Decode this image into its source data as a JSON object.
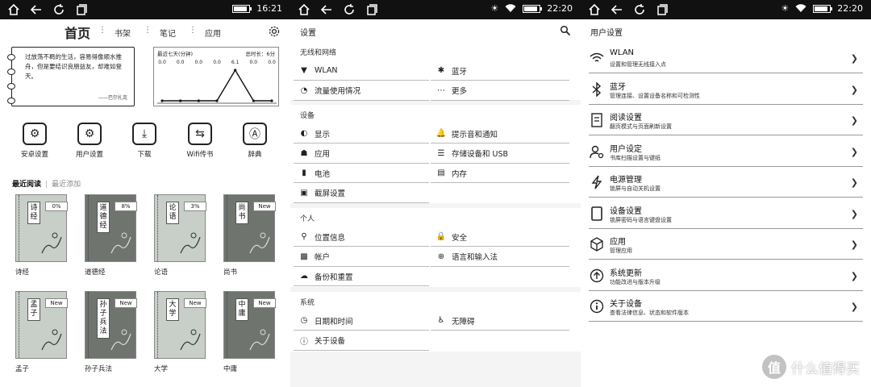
{
  "statusbars": [
    {
      "time": "16:21",
      "show_wifi": false
    },
    {
      "time": "22:20",
      "show_wifi": true
    },
    {
      "time": "22:20",
      "show_wifi": true
    }
  ],
  "home": {
    "title": "首页",
    "tabs": [
      "书架",
      "笔记",
      "应用"
    ],
    "quote": {
      "text": "过放荡不羁的生活，容易得像顺水推舟，但是要结识良朋益友，却难如登天。",
      "author": "——巴尔扎克"
    },
    "stats": {
      "label": "最近七天(分钟)",
      "total": "总时长：6分",
      "chart_data": {
        "type": "line",
        "values": [
          0.0,
          0.0,
          0.0,
          0.0,
          6.1,
          0.0,
          0.0
        ],
        "value_labels": [
          "0.0",
          "0.0",
          "0.0",
          "0.0",
          "6.1",
          "0.0",
          "0.0"
        ],
        "ylim": [
          0,
          6.1
        ]
      }
    },
    "apps": [
      {
        "label": "安卓设置",
        "icon": "gear-icon"
      },
      {
        "label": "用户设置",
        "icon": "gear-icon"
      },
      {
        "label": "下载",
        "icon": "download-icon"
      },
      {
        "label": "Wifi传书",
        "icon": "transfer-icon"
      },
      {
        "label": "辞典",
        "icon": "dictionary-icon"
      }
    ],
    "recent_tab_active": "最近阅读",
    "recent_tab_inactive": "最近添加",
    "books": [
      {
        "title": "诗经",
        "cover_chars": "诗经",
        "badge": "0%",
        "dark": false
      },
      {
        "title": "道德经",
        "cover_chars": "道德经",
        "badge": "8%",
        "dark": true
      },
      {
        "title": "论语",
        "cover_chars": "论语",
        "badge": "3%",
        "dark": false
      },
      {
        "title": "尚书",
        "cover_chars": "尚书",
        "badge": "New",
        "dark": true
      },
      {
        "title": "孟子",
        "cover_chars": "孟子",
        "badge": "New",
        "dark": false
      },
      {
        "title": "孙子兵法",
        "cover_chars": "孙子兵法",
        "badge": "New",
        "dark": true
      },
      {
        "title": "大学",
        "cover_chars": "大学",
        "badge": "New",
        "dark": false
      },
      {
        "title": "中庸",
        "cover_chars": "中庸",
        "badge": "New",
        "dark": true
      }
    ]
  },
  "settings": {
    "title": "设置",
    "sections": [
      {
        "header": "无线和网络",
        "items": [
          {
            "label": "WLAN",
            "icon": "wifi-icon"
          },
          {
            "label": "蓝牙",
            "icon": "bluetooth-icon"
          },
          {
            "label": "流量使用情况",
            "icon": "data-usage-icon"
          },
          {
            "label": "更多",
            "icon": "more-icon"
          }
        ]
      },
      {
        "header": "设备",
        "items": [
          {
            "label": "显示",
            "icon": "brightness-icon"
          },
          {
            "label": "提示音和通知",
            "icon": "bell-icon"
          },
          {
            "label": "应用",
            "icon": "android-icon"
          },
          {
            "label": "存储设备和 USB",
            "icon": "storage-icon"
          },
          {
            "label": "电池",
            "icon": "battery-icon"
          },
          {
            "label": "内存",
            "icon": "memory-icon"
          },
          {
            "label": "截屏设置",
            "icon": "screenshot-icon"
          }
        ]
      },
      {
        "header": "个人",
        "items": [
          {
            "label": "位置信息",
            "icon": "location-icon"
          },
          {
            "label": "安全",
            "icon": "lock-icon"
          },
          {
            "label": "帐户",
            "icon": "account-icon"
          },
          {
            "label": "语言和输入法",
            "icon": "globe-icon"
          },
          {
            "label": "备份和重置",
            "icon": "cloud-icon"
          }
        ]
      },
      {
        "header": "系统",
        "items": [
          {
            "label": "日期和时间",
            "icon": "clock-icon"
          },
          {
            "label": "无障碍",
            "icon": "accessibility-icon"
          },
          {
            "label": "关于设备",
            "icon": "info-icon"
          }
        ]
      }
    ]
  },
  "user_settings": {
    "title": "用户设置",
    "items": [
      {
        "title": "WLAN",
        "subtitle": "设置和管理无线接入点",
        "icon": "wifi-icon"
      },
      {
        "title": "蓝牙",
        "subtitle": "管理连接、设置设备名称和可检测性",
        "icon": "bluetooth-icon"
      },
      {
        "title": "阅读设置",
        "subtitle": "翻页模式与页面刷新设置",
        "icon": "reading-icon"
      },
      {
        "title": "用户设定",
        "subtitle": "书库扫描设置与键纸",
        "icon": "user-gear-icon"
      },
      {
        "title": "电源管理",
        "subtitle": "锁屏与自动关机设置",
        "icon": "lightning-icon"
      },
      {
        "title": "设备设置",
        "subtitle": "锁屏密码与语言键盘设置",
        "icon": "device-icon"
      },
      {
        "title": "应用",
        "subtitle": "管理应用",
        "icon": "cube-icon"
      },
      {
        "title": "系统更新",
        "subtitle": "功能改进与版本升级",
        "icon": "update-icon"
      },
      {
        "title": "关于设备",
        "subtitle": "查看法律信息、状态和软件版本",
        "icon": "info-icon"
      }
    ]
  },
  "watermark": {
    "badge": "值",
    "text": "什么值得买"
  }
}
